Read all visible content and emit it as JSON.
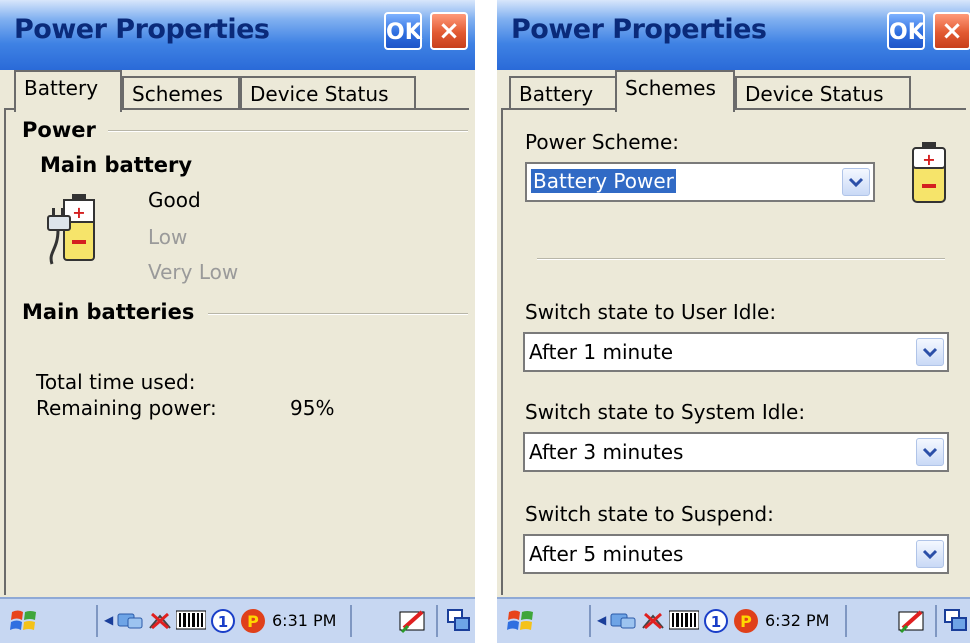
{
  "left": {
    "window_title": "Power Properties",
    "ok_label": "OK",
    "close_label": "×",
    "tabs": [
      {
        "label": "Battery",
        "active": true
      },
      {
        "label": "Schemes",
        "active": false
      },
      {
        "label": "Device Status",
        "active": false
      }
    ],
    "battery": {
      "section_power": "Power",
      "main_battery": "Main battery",
      "levels": [
        "Good",
        "Low",
        "Very Low"
      ],
      "section_main_batteries": "Main batteries",
      "total_time_label": "Total time used:",
      "total_time_value": "",
      "remaining_label": "Remaining power:",
      "remaining_value": "95%"
    },
    "taskbar": {
      "clock": "6:31 PM"
    }
  },
  "right": {
    "window_title": "Power Properties",
    "ok_label": "OK",
    "close_label": "×",
    "tabs": [
      {
        "label": "Battery",
        "active": false
      },
      {
        "label": "Schemes",
        "active": true
      },
      {
        "label": "Device Status",
        "active": false
      }
    ],
    "schemes": {
      "power_scheme_label": "Power Scheme:",
      "power_scheme_value": "Battery Power",
      "user_idle_label": "Switch state to User Idle:",
      "user_idle_value": "After 1 minute",
      "system_idle_label": "Switch state to System Idle:",
      "system_idle_value": "After 3 minutes",
      "suspend_label": "Switch state to Suspend:",
      "suspend_value": "After 5 minutes"
    },
    "taskbar": {
      "clock": "6:32 PM"
    }
  },
  "icons": [
    "windows-start-icon",
    "network-icon",
    "signal-off-icon",
    "barcode-icon",
    "input-1-icon",
    "power-p-icon",
    "pen-input-icon",
    "window-switch-icon",
    "battery-plug-icon",
    "battery-icon"
  ],
  "colors": {
    "title_bar": "#2a6ad8",
    "selection": "#316ac5",
    "close_button": "#e25a32"
  }
}
